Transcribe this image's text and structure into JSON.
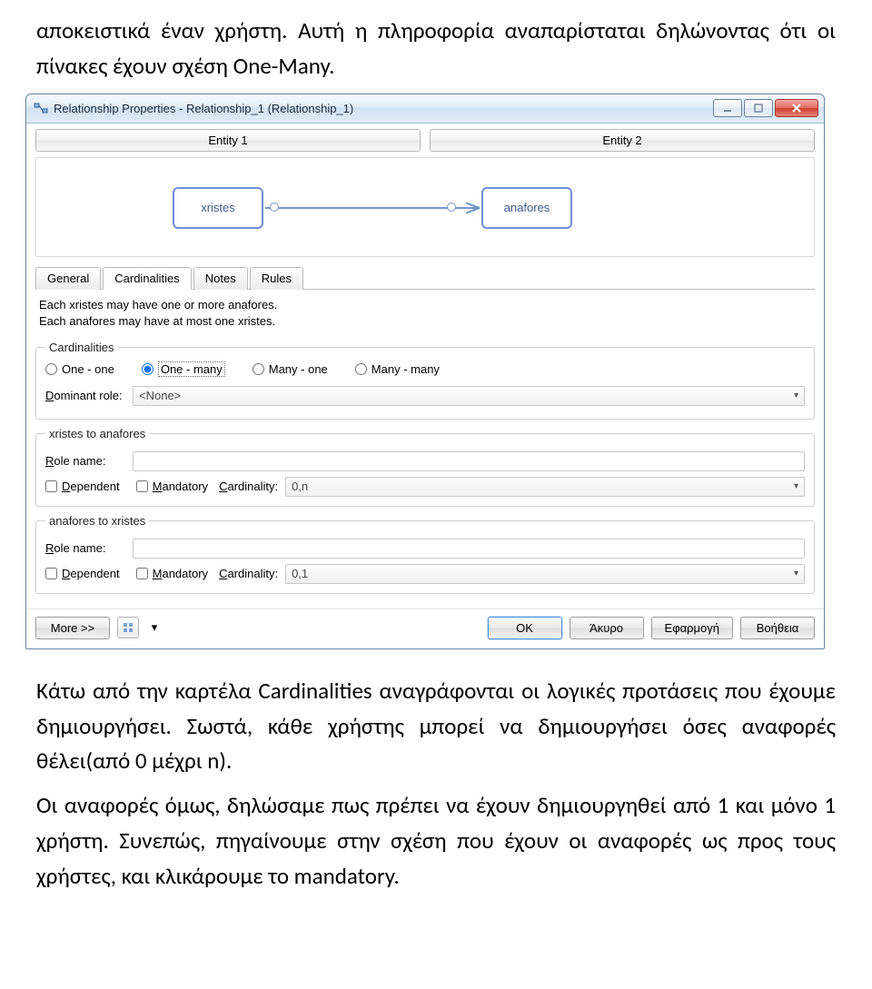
{
  "doc": {
    "para1": "αποκειστικά έναν χρήστη. Αυτή η πληροφορία αναπαρίσταται δηλώνοντας ότι οι πίνακες έχουν σχέση One-Many.",
    "para2": "Κάτω από την καρτέλα Cardinalities αναγράφονται οι λογικές προτάσεις που έχουμε δημιουργήσει. Σωστά, κάθε χρήστης μπορεί να δημιουργήσει όσες αναφορές θέλει(από 0 μέχρι n).",
    "para3": "Οι αναφορές όμως, δηλώσαμε πως πρέπει να έχουν δημιουργηθεί από 1 και μόνο 1 χρήστη. Συνεπώς, πηγαίνουμε στην σχέση που έχουν οι αναφορές ως προς τους χρήστες, και κλικάρουμε το mandatory."
  },
  "dialog": {
    "title": "Relationship Properties - Relationship_1 (Relationship_1)",
    "entityHeaders": {
      "left": "Entity 1",
      "right": "Entity 2"
    },
    "entities": {
      "left": "xristes",
      "right": "anafores"
    },
    "tabs": {
      "t0": "General",
      "t1": "Cardinalities",
      "t2": "Notes",
      "t3": "Rules"
    },
    "desc": {
      "line1": "Each xristes may have one or more anafores.",
      "line2": "Each anafores may have at most one xristes."
    },
    "cardinalitiesGroup": {
      "legend": "Cardinalities",
      "opt_one_one": "One - one",
      "opt_one_many": "One - many",
      "opt_many_one": "Many - one",
      "opt_many_many": "Many - many",
      "dominant_label_prefix": "D",
      "dominant_label_rest": "ominant role:",
      "dominant_value": "<None>"
    },
    "dir1": {
      "legend": "xristes to anafores",
      "role_label_prefix": "R",
      "role_label_rest": "ole name:",
      "role_value": "",
      "dependent_prefix": "D",
      "dependent_rest": "ependent",
      "mandatory_prefix": "M",
      "mandatory_rest": "andatory",
      "cardinality_label_prefix": "C",
      "cardinality_label_rest": "ardinality:",
      "cardinality_value": "0,n"
    },
    "dir2": {
      "legend": "anafores to xristes",
      "role_label_prefix": "R",
      "role_label_rest": "ole name:",
      "role_value": "",
      "dependent_prefix": "D",
      "dependent_rest": "ependent",
      "mandatory_prefix": "M",
      "mandatory_rest": "andatory",
      "cardinality_label_prefix": "C",
      "cardinality_label_rest": "ardinality:",
      "cardinality_value": "0,1"
    },
    "footer": {
      "more": "More >>",
      "ok": "OK",
      "cancel": "Άκυρο",
      "apply": "Εφαρμογή",
      "help": "Βοήθεια"
    }
  }
}
